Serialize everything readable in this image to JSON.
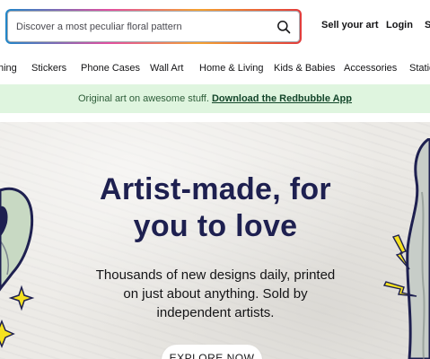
{
  "header": {
    "search": {
      "placeholder": "Discover a most peculiar floral pattern"
    },
    "sell_label": "Sell your art",
    "login_label": "Login",
    "signup_label": "S"
  },
  "categories": [
    "hing",
    "Stickers",
    "Phone Cases",
    "Wall Art",
    "Home & Living",
    "Kids & Babies",
    "Accessories",
    "Statio"
  ],
  "promo": {
    "text": "Original art on awesome stuff.",
    "link": "Download the Redbubble App"
  },
  "hero": {
    "title_line1": "Artist-made, for",
    "title_line2": "you to love",
    "subtitle_line1": "Thousands of new designs daily, printed",
    "subtitle_line2": "on just about anything. Sold by",
    "subtitle_line3": "independent artists.",
    "cta": "EXPLORE NOW"
  },
  "colors": {
    "promo_bg": "#dff5df",
    "hero_title": "#1e2050",
    "hero_bg": "#eceae6",
    "sparkle": "#f5e11f"
  }
}
